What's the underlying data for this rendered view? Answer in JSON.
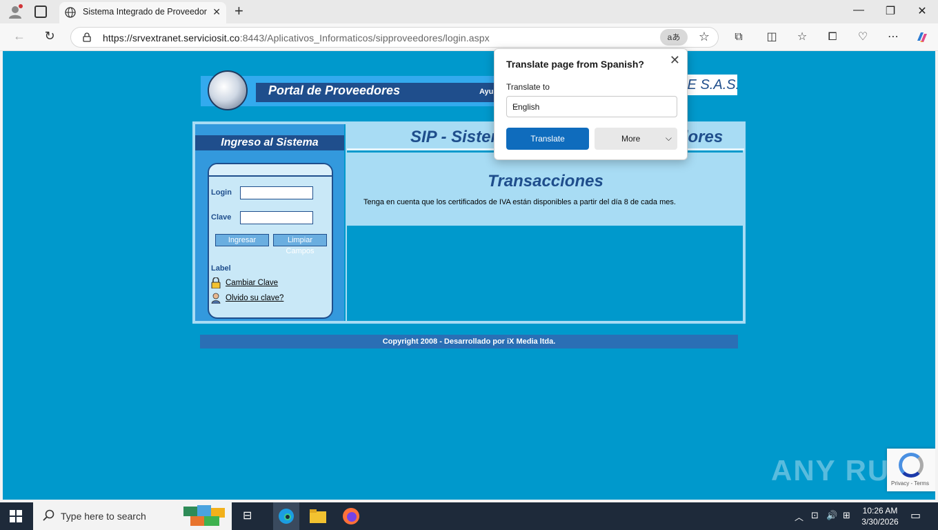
{
  "browser": {
    "tab_title": "Sistema Integrado de Proveedores",
    "url_host": "https://srvextranet.serviciosit.co",
    "url_rest": ":8443/Aplicativos_Informaticos/sipproveedores/login.aspx",
    "translate_glyph": "aあ"
  },
  "header": {
    "portal_title": "Portal de Proveedores",
    "help_link": "Ayu",
    "company": "IE S.A.S."
  },
  "login": {
    "heading": "Ingreso al Sistema",
    "login_label": "Login",
    "login_value": "",
    "password_label": "Clave",
    "password_value": "",
    "submit_label": "Ingresar",
    "clear_label": "Limpiar Campos",
    "section_label": "Label",
    "change_password_link": "Cambiar Clave",
    "forgot_password_link": "Olvido su clave?"
  },
  "content": {
    "sip_title": "SIP - Sistem",
    "sip_title_end": "lores",
    "transactions_title": "Transacciones",
    "transactions_text": "Tenga en cuenta que los certificados de IVA están disponibles a partir del día 8 de cada mes."
  },
  "footer": {
    "copyright": "Copyright 2008 - Desarrollado por iX Media ltda."
  },
  "translate_popup": {
    "title": "Translate page from Spanish?",
    "translate_to_label": "Translate to",
    "selected_language": "English",
    "translate_button": "Translate",
    "more_button": "More"
  },
  "watermark": {
    "anyrun": "ANY RUN",
    "recaptcha_text": "Privacy - Terms"
  },
  "taskbar": {
    "search_placeholder": "Type here to search",
    "time": "10:26 AM",
    "date": "3/30/2026"
  },
  "colors": {
    "page_bg": "#0099cc",
    "navy": "#1f4e8c",
    "light_blue": "#a8dcf4",
    "edge_blue": "#0f6cbd"
  }
}
